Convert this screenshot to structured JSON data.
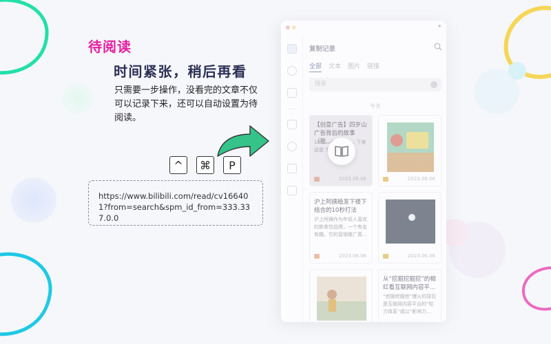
{
  "promo": {
    "accent_title": "待阅读",
    "headline": "时间紧张，稍后再看",
    "description": "只需要一步操作，没看完的文章不仅可以记录下来，还可以自动设置为待阅读。",
    "keys": [
      "^",
      "⌘",
      "P"
    ],
    "url": "https://www.bilibili.com/read/cv166401?from=search&spm_id_from=333.337.0.0"
  },
  "app": {
    "title": "复制记录",
    "tabs": [
      {
        "label": "全部",
        "active": true
      },
      {
        "label": "文本",
        "active": false
      },
      {
        "label": "图片",
        "active": false
      },
      {
        "label": "链接",
        "active": false
      }
    ],
    "search_placeholder": "搜索",
    "day_label": "今天",
    "cards": [
      {
        "type": "text",
        "title": "【创意广告】四岁山广告背后的故事（我...",
        "snippet": "105/... 你的街头... 下来 这是 7 10岁的...",
        "date": "2023.06.06",
        "reading": true
      },
      {
        "type": "image",
        "title": "",
        "snippet": "",
        "date": "2023.06.06",
        "reading": false
      },
      {
        "type": "text",
        "title": "沪上阿姨植发下楼下结合的10秒打法",
        "snippet": "沪上阿姨作为年轻人喜欢的新茶饮品牌，一个有名有趣，它的营销推广真...",
        "date": "2023.06.06",
        "reading": false
      },
      {
        "type": "image",
        "title": "",
        "snippet": "",
        "date": "2023.06.06",
        "reading": false
      },
      {
        "type": "image",
        "title": "",
        "snippet": "",
        "date": "",
        "reading": false
      },
      {
        "type": "text",
        "title": "从“挖掘挖掘挖”的相红看互联网内容平...",
        "snippet": "“挖掘挖掘挖”爆火的背后是互联网内容平台的“粒力体系”或以“影响力...",
        "date": "",
        "reading": false
      }
    ]
  },
  "colors": {
    "accent": "#e61ea0",
    "headline": "#2c2f55",
    "decor_green": "#22e0a8",
    "decor_cyan": "#1ec9e6",
    "decor_yellow": "#f5c400",
    "decor_magenta": "#e61ea0"
  },
  "icons": {
    "reader": "book-icon",
    "arrow": "curved-arrow-icon",
    "search": "search-icon"
  }
}
